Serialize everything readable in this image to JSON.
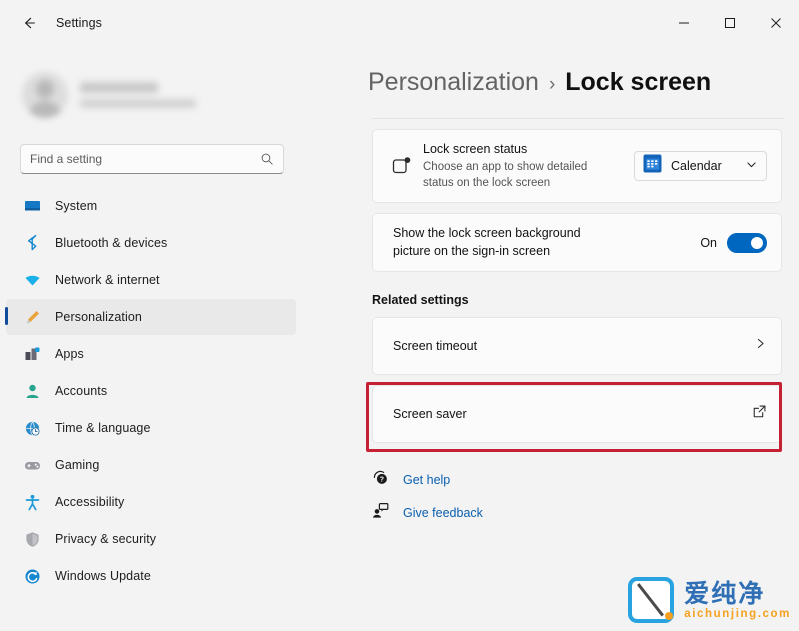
{
  "window": {
    "title": "Settings",
    "back_icon": "arrow-left-icon",
    "controls": {
      "minimize": "minimize-icon",
      "maximize": "maximize-icon",
      "close": "close-icon"
    }
  },
  "sidebar": {
    "account": {
      "name": "",
      "email": "",
      "redacted": true
    },
    "search": {
      "placeholder": "Find a setting",
      "value": "",
      "icon": "search-icon"
    },
    "items": [
      {
        "label": "System",
        "icon": "system-icon",
        "selected": false
      },
      {
        "label": "Bluetooth & devices",
        "icon": "bluetooth-icon",
        "selected": false
      },
      {
        "label": "Network & internet",
        "icon": "wifi-icon",
        "selected": false
      },
      {
        "label": "Personalization",
        "icon": "paintbrush-icon",
        "selected": true
      },
      {
        "label": "Apps",
        "icon": "apps-icon",
        "selected": false
      },
      {
        "label": "Accounts",
        "icon": "person-icon",
        "selected": false
      },
      {
        "label": "Time & language",
        "icon": "clock-globe-icon",
        "selected": false
      },
      {
        "label": "Gaming",
        "icon": "gamepad-icon",
        "selected": false
      },
      {
        "label": "Accessibility",
        "icon": "accessibility-icon",
        "selected": false
      },
      {
        "label": "Privacy & security",
        "icon": "shield-icon",
        "selected": false
      },
      {
        "label": "Windows Update",
        "icon": "update-icon",
        "selected": false
      }
    ]
  },
  "main": {
    "breadcrumb": {
      "parent": "Personalization",
      "separator": "›",
      "current": "Lock screen"
    },
    "lock_screen_status": {
      "icon": "lock-screen-status-icon",
      "title": "Lock screen status",
      "description": "Choose an app to show detailed status on the lock screen",
      "dropdown": {
        "value": "Calendar",
        "icon": "calendar-icon",
        "chevron": "chevron-down-icon"
      }
    },
    "background_toggle": {
      "label": "Show the lock screen background picture on the sign-in screen",
      "state_label": "On",
      "state": true
    },
    "related_settings_heading": "Related settings",
    "screen_timeout": {
      "label": "Screen timeout",
      "chevron": "chevron-right-icon",
      "highlighted": true
    },
    "screen_saver": {
      "label": "Screen saver",
      "icon": "external-link-icon"
    },
    "footer_links": [
      {
        "label": "Get help",
        "icon": "help-icon"
      },
      {
        "label": "Give feedback",
        "icon": "feedback-icon"
      }
    ]
  },
  "watermark": {
    "chinese": "爱纯净",
    "domain": "aichunjing.com"
  },
  "colors": {
    "accent": "#0067c0",
    "selection_indicator": "#0f4b9b",
    "annotation_red": "#c62035",
    "link_blue": "#0b5fb0",
    "watermark_blue": "#29a3e0",
    "watermark_orange": "#f5a01e",
    "window_bg": "#f3f3f3",
    "card_bg": "#fbfbfb"
  }
}
